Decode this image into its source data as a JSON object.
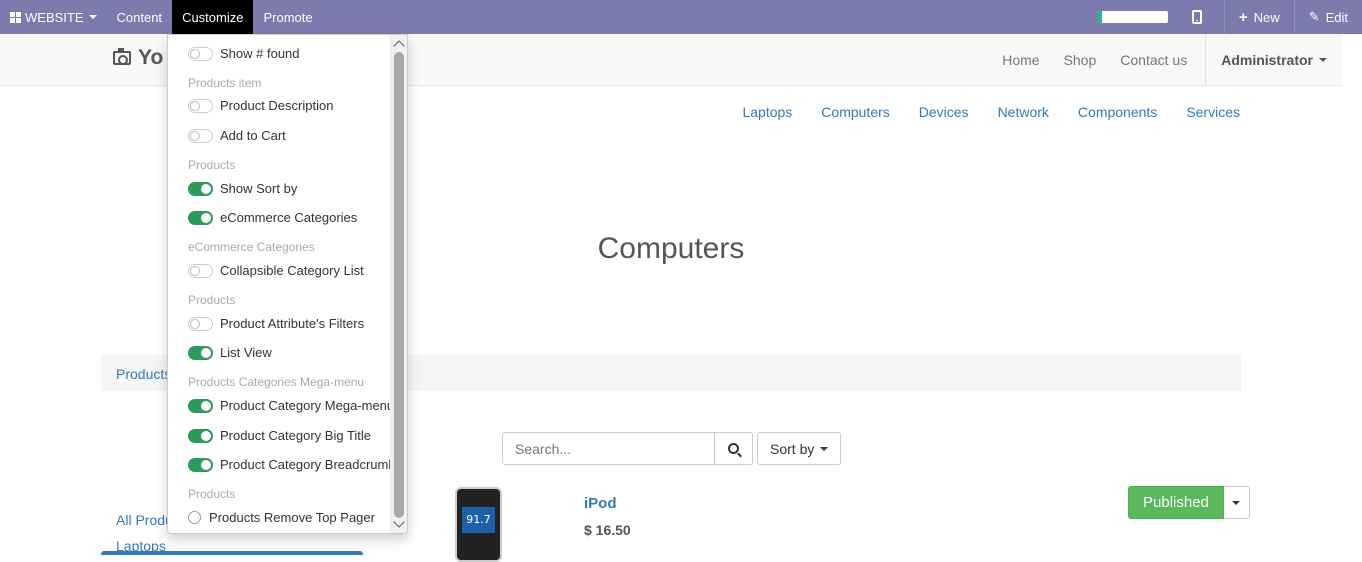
{
  "topbar": {
    "website_label": "WEBSITE",
    "content_label": "Content",
    "customize_label": "Customize",
    "promote_label": "Promote",
    "new_label": "New",
    "edit_label": "Edit",
    "progress_fraction": 0.06
  },
  "site": {
    "logo_text": "Yo",
    "nav": [
      "Home",
      "Shop",
      "Contact us"
    ],
    "admin_label": "Administrator"
  },
  "categories": [
    "Laptops",
    "Computers",
    "Devices",
    "Network",
    "Components",
    "Services"
  ],
  "page_title": "Computers",
  "breadcrumb": "Products",
  "search": {
    "placeholder": "Search..."
  },
  "sort_label": "Sort by",
  "left_categories": [
    "All Produ",
    "Laptops"
  ],
  "product": {
    "name": "iPod",
    "price": "$ 16.50",
    "screen_text": "91.7",
    "publish_label": "Published"
  },
  "customize_menu": {
    "show_found": "Show # found",
    "header_products_item": "Products item",
    "product_description": "Product Description",
    "add_to_cart": "Add to Cart",
    "header_products_1": "Products",
    "show_sort_by": "Show Sort by",
    "ecommerce_categories": "eCommerce Categories",
    "header_ecommerce_categories": "eCommerce Categories",
    "collapsible_category_list": "Collapsible Category List",
    "header_products_2": "Products",
    "product_attribute_filters": "Product Attribute's Filters",
    "list_view": "List View",
    "header_mega_menu": "Products Categories Mega-menu",
    "product_category_mega_menu": "Product Category Mega-menu",
    "product_category_big_title": "Product Category Big Title",
    "product_category_breadcrumb": "Product Category Breadcrumb",
    "header_products_3": "Products",
    "products_remove_top_pager": "Products Remove Top Pager"
  }
}
